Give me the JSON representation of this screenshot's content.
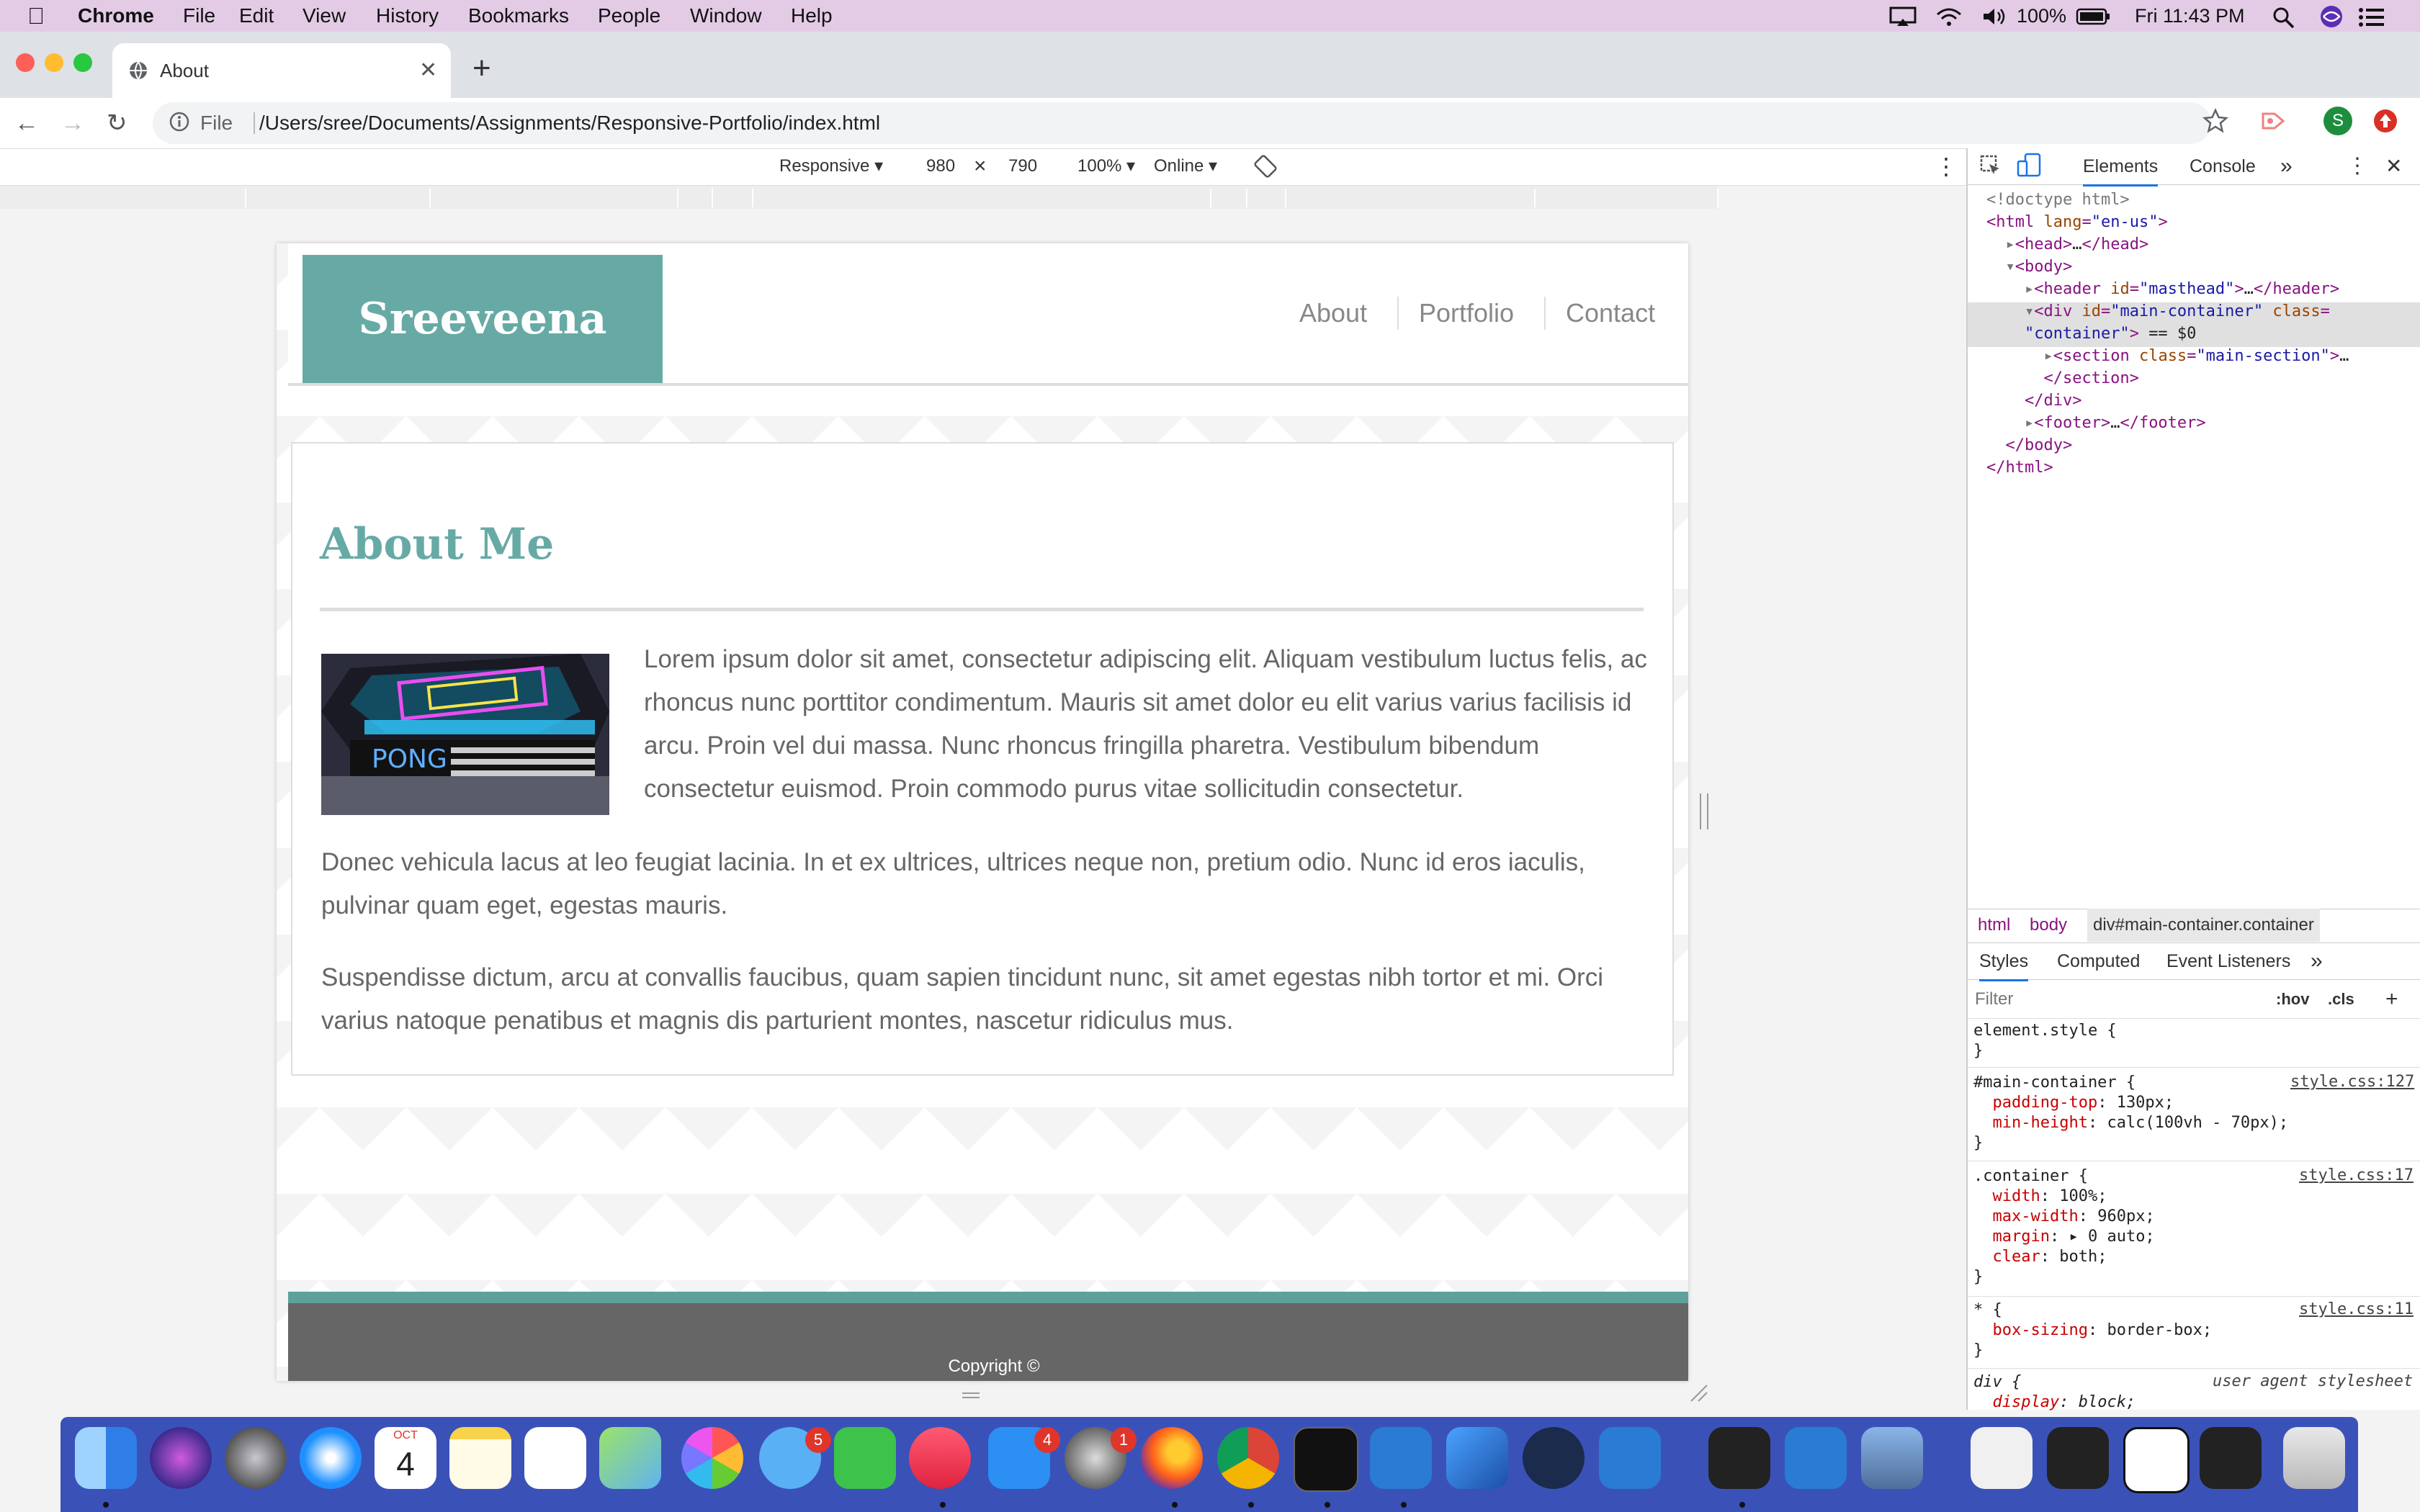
{
  "menubar": {
    "apple": "",
    "items": [
      "Chrome",
      "File",
      "Edit",
      "View",
      "History",
      "Bookmarks",
      "People",
      "Window",
      "Help"
    ],
    "battery": "100%",
    "clock": "Fri 11:43 PM"
  },
  "browser": {
    "tab_title": "About",
    "omnibox_scheme": "File",
    "url": "/Users/sree/Documents/Assignments/Responsive-Portfolio/index.html",
    "profile_initial": "S"
  },
  "device_toolbar": {
    "device": "Responsive",
    "width": "980",
    "height": "790",
    "times": "×",
    "zoom": "100%",
    "network": "Online"
  },
  "site": {
    "logo": "Sreeveena",
    "nav": [
      "About",
      "Portfolio",
      "Contact"
    ],
    "heading": "About Me",
    "photo_label": "PONG",
    "paragraphs": [
      "Lorem ipsum dolor sit amet, consectetur adipiscing elit. Aliquam vestibulum luctus felis, ac rhoncus nunc porttitor condimentum. Mauris sit amet dolor eu elit varius varius facilisis id arcu. Proin vel dui massa. Nunc rhoncus fringilla pharetra. Vestibulum bibendum consectetur euismod. Proin commodo purus vitae sollicitudin consectetur.",
      "Donec vehicula lacus at leo feugiat lacinia. In et ex ultrices, ultrices neque non, pretium odio. Nunc id eros iaculis, pulvinar quam eget, egestas mauris.",
      "Suspendisse dictum, arcu at convallis faucibus, quam sapien tincidunt nunc, sit amet egestas nibh tortor et mi. Orci varius natoque penatibus et magnis dis parturient montes, nascetur ridiculus mus."
    ],
    "copyright": "Copyright ©"
  },
  "devtools": {
    "tabs": [
      "Elements",
      "Console"
    ],
    "more": "»",
    "breadcrumbs": [
      "html",
      "body",
      "div#main-container.container"
    ],
    "style_tabs": [
      "Styles",
      "Computed",
      "Event Listeners"
    ],
    "filter_placeholder": "Filter",
    "hov": ":hov",
    "cls": ".cls",
    "sources": [
      "style.css:127",
      "style.css:17",
      "style.css:11",
      "user agent stylesheet"
    ]
  },
  "dock": {
    "calendar_month": "OCT",
    "calendar_day": "4",
    "badges": [
      "5",
      "4",
      "1"
    ]
  }
}
